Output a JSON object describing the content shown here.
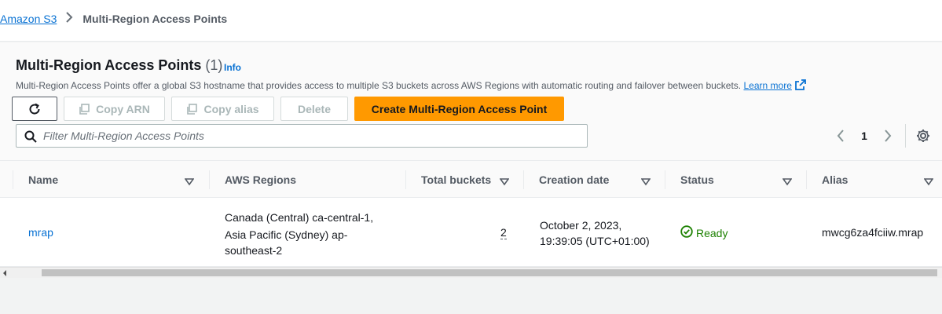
{
  "breadcrumb": {
    "root": "Amazon S3",
    "current": "Multi-Region Access Points"
  },
  "header": {
    "title": "Multi-Region Access Points",
    "count": "(1)",
    "info": "Info",
    "description": "Multi-Region Access Points offer a global S3 hostname that provides access to multiple S3 buckets across AWS Regions with automatic routing and failover between buckets.",
    "learn_more": "Learn more"
  },
  "toolbar": {
    "copy_arn": "Copy ARN",
    "copy_alias": "Copy alias",
    "delete": "Delete",
    "create": "Create Multi-Region Access Point"
  },
  "filter": {
    "placeholder": "Filter Multi-Region Access Points"
  },
  "pagination": {
    "page": "1"
  },
  "table": {
    "columns": [
      "Name",
      "AWS Regions",
      "Total buckets",
      "Creation date",
      "Status",
      "Alias"
    ],
    "rows": [
      {
        "name": "mrap",
        "region_line1": "Canada (Central) ca-central-1,",
        "region_line2": "Asia Pacific (Sydney) ap-",
        "region_line3": "southeast-2",
        "total_buckets": "2",
        "date_line1": "October 2, 2023,",
        "date_line2": "19:39:05 (UTC+01:00)",
        "status": "Ready",
        "alias": "mwcg6za4fciiw.mrap"
      }
    ]
  },
  "colors": {
    "accent": "#0972d3",
    "primary": "#ff9900",
    "success": "#1d8102"
  }
}
